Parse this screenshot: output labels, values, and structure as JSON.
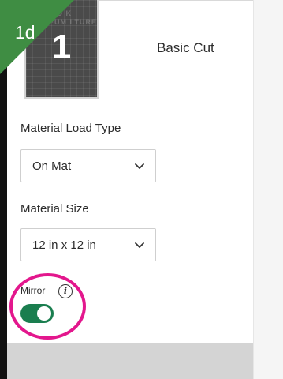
{
  "step": {
    "label": "1d"
  },
  "mat": {
    "number": "1",
    "art_text": "SO K\nSEUM LTURE"
  },
  "cut": {
    "title": "Basic Cut"
  },
  "material_load_type": {
    "label": "Material Load Type",
    "selected": "On Mat"
  },
  "material_size": {
    "label": "Material Size",
    "selected": "12 in x 12 in"
  },
  "mirror": {
    "label": "Mirror",
    "enabled": true
  },
  "icons": {
    "info": "info-icon",
    "chevron": "chevron-down-icon"
  },
  "colors": {
    "step_badge": "#3f8d43",
    "toggle_on": "#1a7e4f",
    "highlight": "#e3178d"
  }
}
